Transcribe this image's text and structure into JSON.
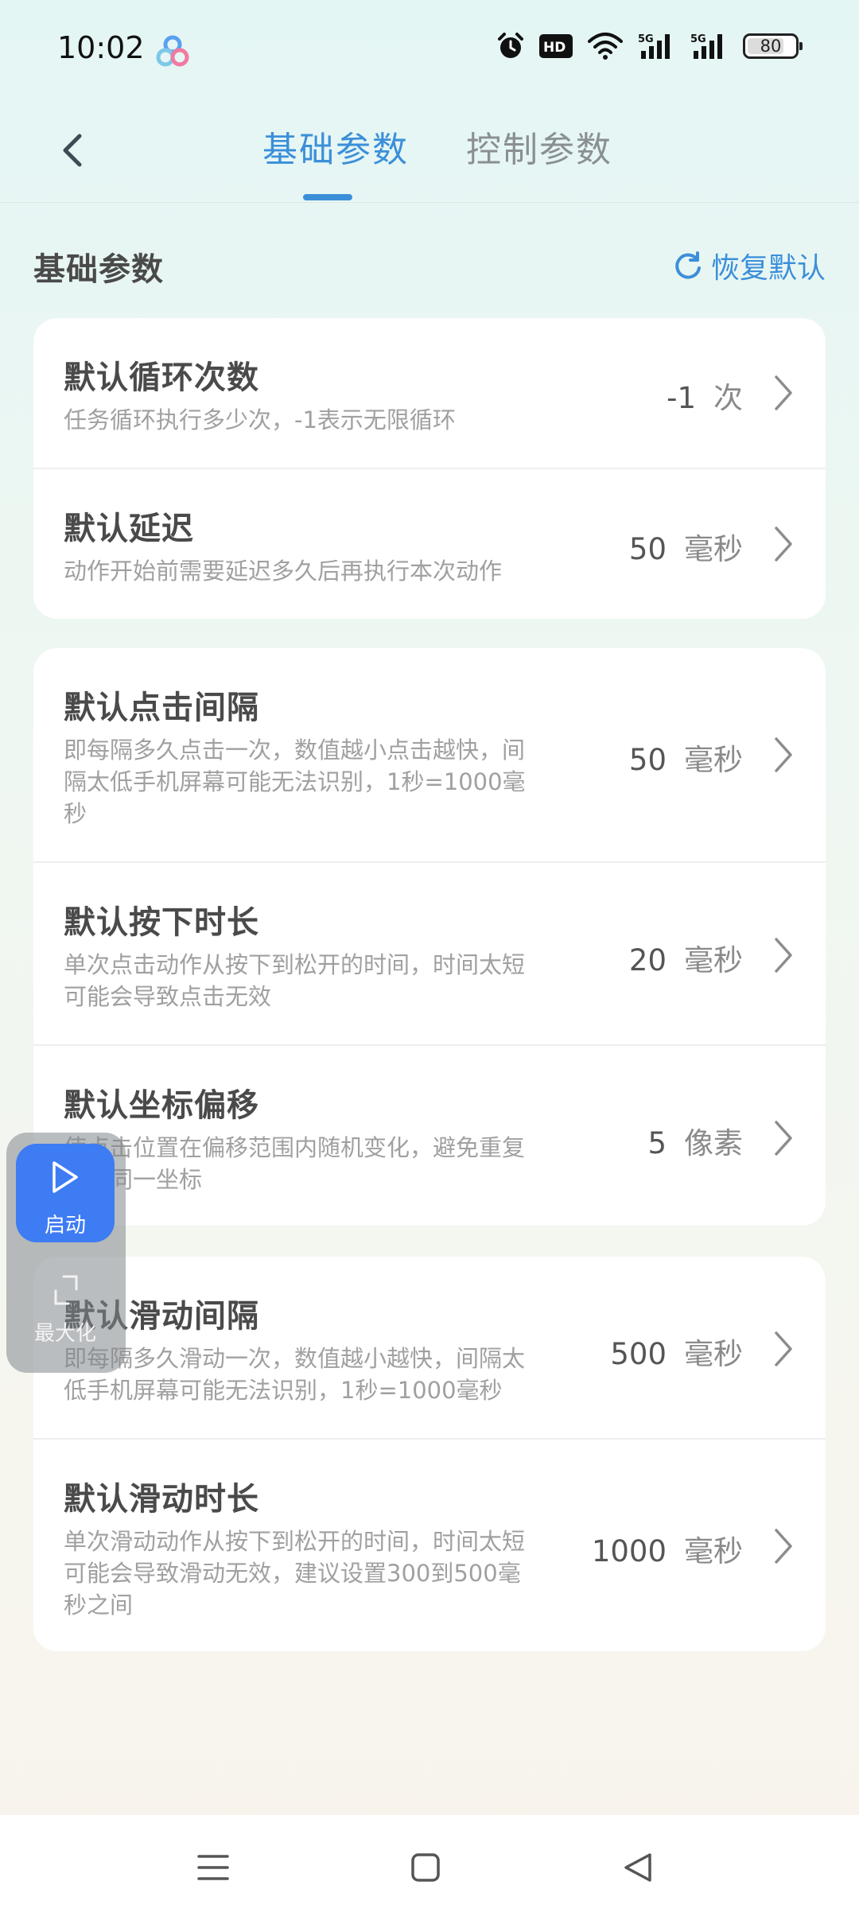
{
  "status_bar": {
    "time": "10:02",
    "battery_level": "80",
    "icons": [
      "app-logo-icon",
      "alarm-icon",
      "hd-icon",
      "wifi-icon",
      "5g-signal-icon",
      "5g-signal-icon",
      "battery-icon"
    ]
  },
  "header": {
    "tabs": [
      {
        "label": "基础参数",
        "active": true
      },
      {
        "label": "控制参数",
        "active": false
      }
    ]
  },
  "section": {
    "title": "基础参数",
    "restore_label": "恢复默认"
  },
  "settings": [
    {
      "title": "默认循环次数",
      "desc": "任务循环执行多少次，-1表示无限循环",
      "value": "-1",
      "unit": "次"
    },
    {
      "title": "默认延迟",
      "desc": "动作开始前需要延迟多久后再执行本次动作",
      "value": "50",
      "unit": "毫秒"
    },
    {
      "title": "默认点击间隔",
      "desc": "即每隔多久点击一次，数值越小点击越快，间隔太低手机屏幕可能无法识别，1秒=1000毫秒",
      "value": "50",
      "unit": "毫秒"
    },
    {
      "title": "默认按下时长",
      "desc": "单次点击动作从按下到松开的时间，时间太短可能会导致点击无效",
      "value": "20",
      "unit": "毫秒"
    },
    {
      "title": "默认坐标偏移",
      "desc": "使点击位置在偏移范围内随机变化，避免重复点击同一坐标",
      "value": "5",
      "unit": "像素"
    },
    {
      "title": "默认滑动间隔",
      "desc": "即每隔多久滑动一次，数值越小越快，间隔太低手机屏幕可能无法识别，1秒=1000毫秒",
      "value": "500",
      "unit": "毫秒"
    },
    {
      "title": "默认滑动时长",
      "desc": "单次滑动动作从按下到松开的时间，时间太短可能会导致滑动无效，建议设置300到500毫秒之间",
      "value": "1000",
      "unit": "毫秒"
    }
  ],
  "float_widget": {
    "start_label": "启动",
    "maximize_label": "最大化"
  },
  "colors": {
    "accent": "#3b8fd9",
    "start_button": "#3e7cf4"
  }
}
